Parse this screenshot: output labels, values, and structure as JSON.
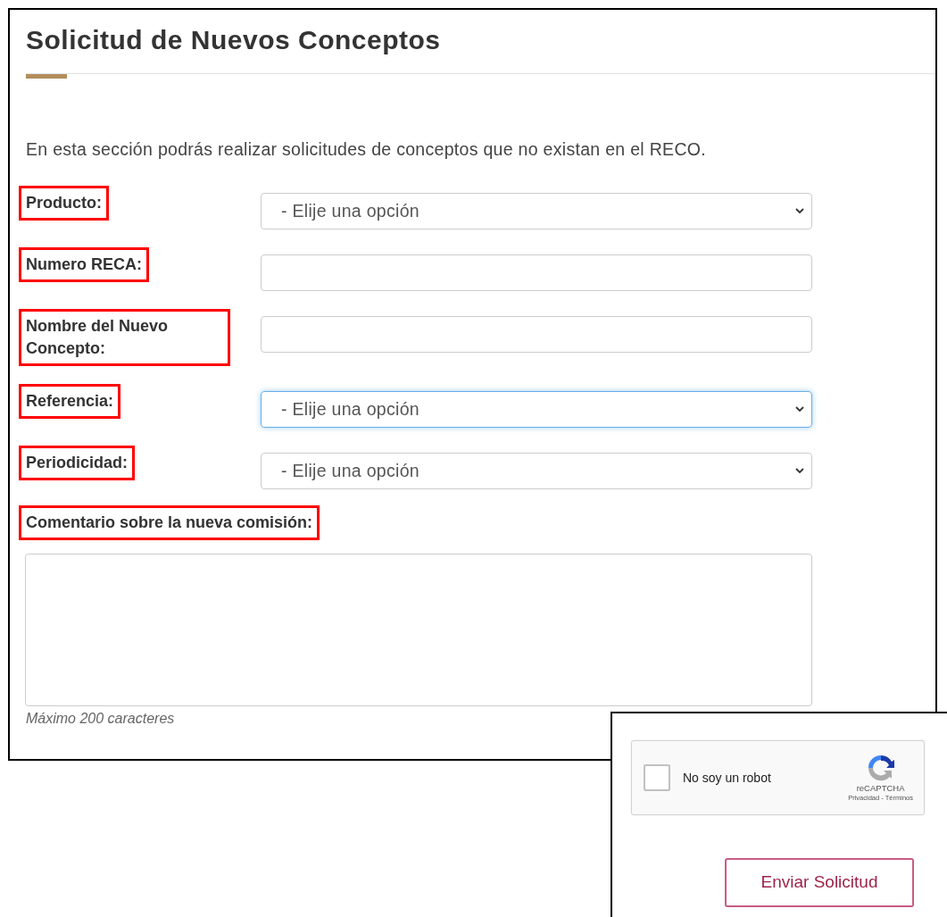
{
  "page": {
    "title": "Solicitud de Nuevos Conceptos",
    "intro": "En esta sección podrás realizar solicitudes de conceptos que no existan en el RECO."
  },
  "fields": [
    {
      "kind": "select",
      "label": "Producto:",
      "placeholder": "- Elije una opción",
      "highlighted": true,
      "focused": false
    },
    {
      "kind": "text",
      "label": "Numero RECA:",
      "highlighted": true,
      "focused": false
    },
    {
      "kind": "text",
      "label": "Nombre del Nuevo Concepto:",
      "highlighted": true,
      "focused": false
    },
    {
      "kind": "select",
      "label": "Referencia:",
      "placeholder": "- Elije una opción",
      "highlighted": true,
      "focused": true
    },
    {
      "kind": "select",
      "label": "Periodicidad:",
      "placeholder": "- Elije una opción",
      "highlighted": true,
      "focused": false
    }
  ],
  "comment": {
    "label": "Comentario sobre la nueva comisión:",
    "highlighted": true,
    "hint": "Máximo 200 caracteres"
  },
  "captcha": {
    "label": "No soy un robot",
    "checked": false,
    "brand": "reCAPTCHA",
    "links": "Privacidad - Términos"
  },
  "submit": {
    "label": "Enviar Solicitud"
  }
}
